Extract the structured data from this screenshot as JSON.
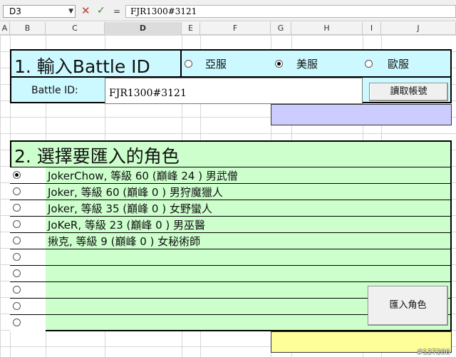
{
  "formula_bar": {
    "name_box": "D3",
    "cancel_symbol": "✕",
    "enter_symbol": "✓",
    "fx_symbol": "=",
    "formula_value": "FJR1300#3121"
  },
  "columns": [
    "A",
    "B",
    "C",
    "D",
    "E",
    "F",
    "G",
    "H",
    "I",
    "J"
  ],
  "selected_column": "D",
  "section1": {
    "title": "1. 輸入Battle ID",
    "regions": [
      {
        "label": "亞服",
        "selected": false
      },
      {
        "label": "美服",
        "selected": true
      },
      {
        "label": "歐服",
        "selected": false
      }
    ],
    "battle_id_label": "Battle ID:",
    "battle_id_value": "FJR1300#3121",
    "read_button": "讀取帳號"
  },
  "section2": {
    "title": "2. 選擇要匯入的角色",
    "characters": [
      {
        "label": "JokerChow, 等級 60 (巔峰 24 ) 男武僧",
        "selected": true
      },
      {
        "label": "Joker, 等級 60 (巔峰 0 ) 男狩魔獵人",
        "selected": false
      },
      {
        "label": "Joker, 等級 35 (巔峰 0 ) 女野蠻人",
        "selected": false
      },
      {
        "label": "JoKeR, 等級 23 (巔峰 0 ) 男巫醫",
        "selected": false
      },
      {
        "label": "揪克, 等級 9 (巔峰 0 ) 女秘術師",
        "selected": false
      },
      {
        "label": "",
        "selected": false
      },
      {
        "label": "",
        "selected": false
      },
      {
        "label": "",
        "selected": false
      },
      {
        "label": "",
        "selected": false
      },
      {
        "label": "",
        "selected": false
      }
    ],
    "import_button": "匯入角色"
  },
  "colors": {
    "section1_bg": "#ccf9ff",
    "section2_bg": "#ccffcc",
    "purple_cell": "#ccccff",
    "yellow_cell": "#ffff99"
  },
  "watermark": "#127206"
}
